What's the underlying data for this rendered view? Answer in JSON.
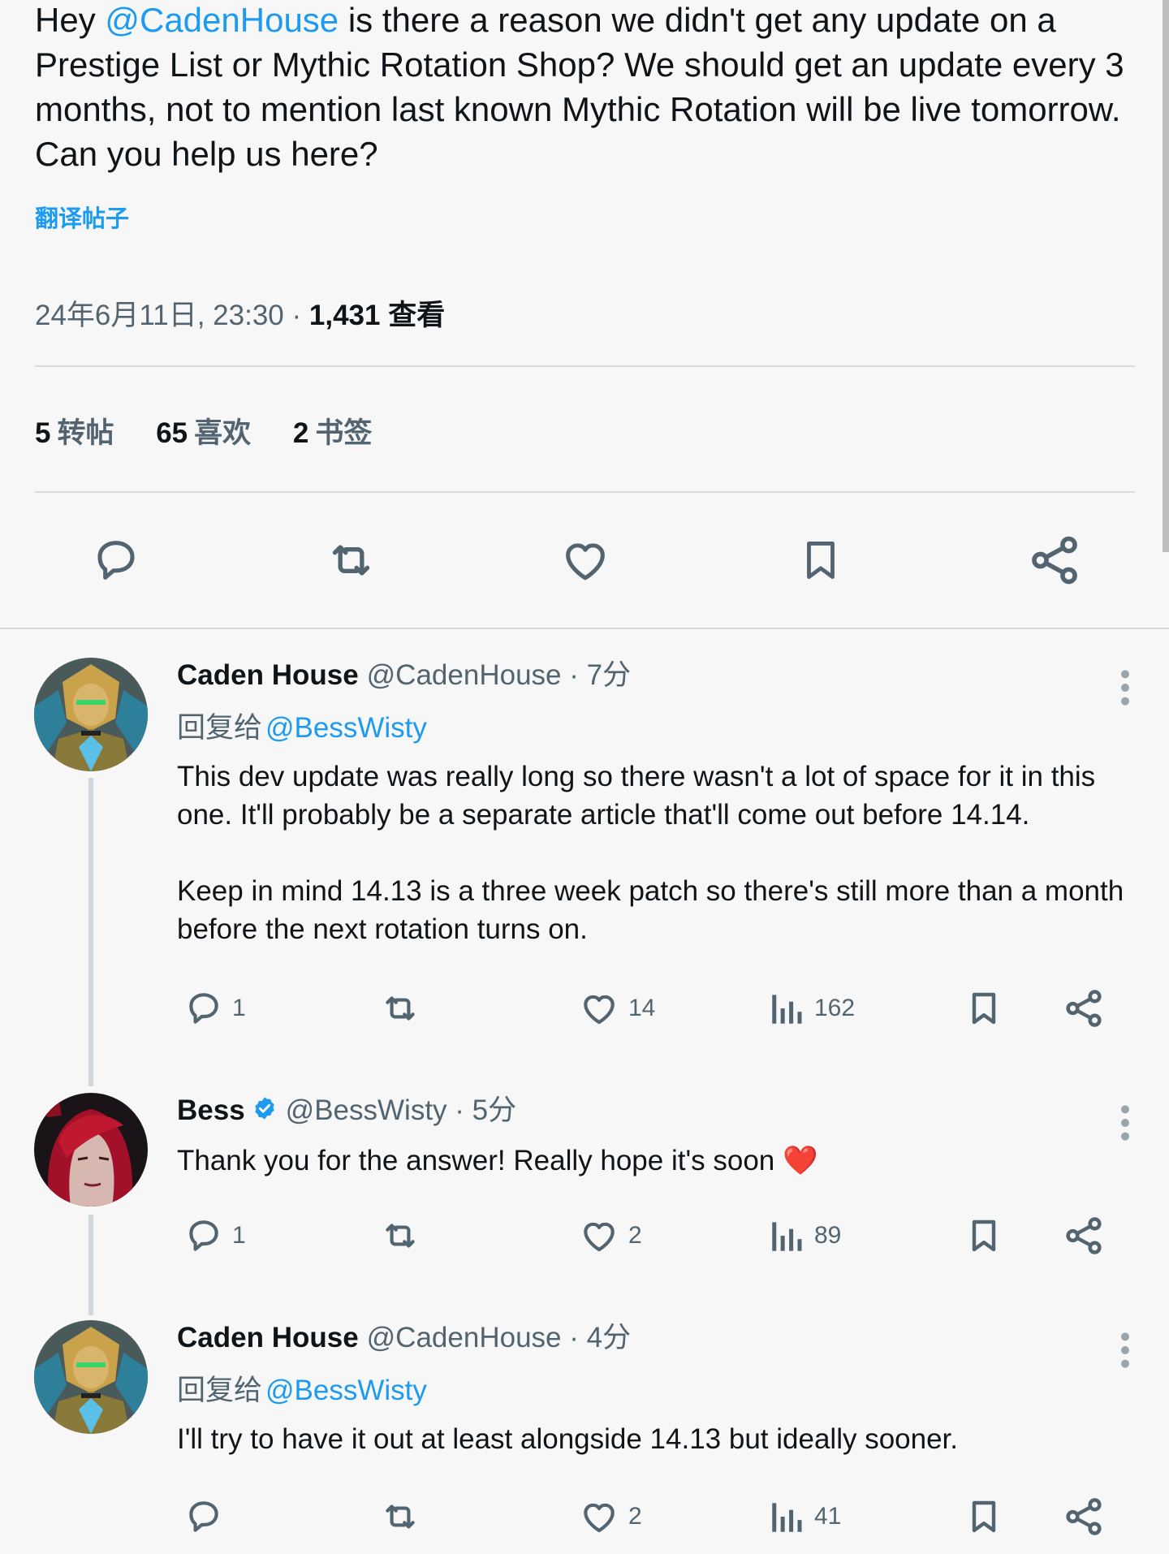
{
  "tweet": {
    "text_prefix": "Hey ",
    "mention": "@CadenHouse",
    "text_suffix": " is there a reason we didn't get any update on a Prestige List or Mythic Rotation Shop? We should get an update every 3 months, not to mention last known Mythic Rotation will be live tomorrow. Can you help us here?",
    "translate": "翻译帖子",
    "timestamp": "24年6月11日, 23:30",
    "separator": "·",
    "views_count": "1,431",
    "views_label": "查看"
  },
  "stats": [
    {
      "count": "5",
      "label": "转帖"
    },
    {
      "count": "65",
      "label": "喜欢"
    },
    {
      "count": "2",
      "label": "书签"
    }
  ],
  "replies": [
    {
      "name": "Caden House",
      "handle": "@CadenHouse",
      "time": "· 7分",
      "replying_label": "回复给",
      "replying_to": "@BessWisty",
      "text": "This dev update was really long so there wasn't a lot of space for it in this one. It'll probably be a separate article that'll come out before 14.14.\n\nKeep in mind 14.13 is a three week patch so there's still more than a month before the next rotation turns on.",
      "replies": "1",
      "likes": "14",
      "views": "162"
    },
    {
      "name": "Bess",
      "handle": "@BessWisty",
      "time": "· 5分",
      "text": "Thank you for the answer! Really hope it's soon ❤️",
      "replies": "1",
      "likes": "2",
      "views": "89"
    },
    {
      "name": "Caden House",
      "handle": "@CadenHouse",
      "time": "· 4分",
      "replying_label": "回复给",
      "replying_to": "@BessWisty",
      "text": "I'll try to have it out at least alongside 14.13 but ideally sooner.",
      "replies": "",
      "likes": "2",
      "views": "41"
    }
  ],
  "colors": {
    "accent": "#1d9bf0",
    "text": "#0f1419",
    "secondary": "#536471",
    "background": "#f7f7f7"
  },
  "icons": [
    "reply-icon",
    "retweet-icon",
    "like-icon",
    "bookmark-icon",
    "share-icon",
    "views-icon",
    "more-icon",
    "verified-icon"
  ]
}
